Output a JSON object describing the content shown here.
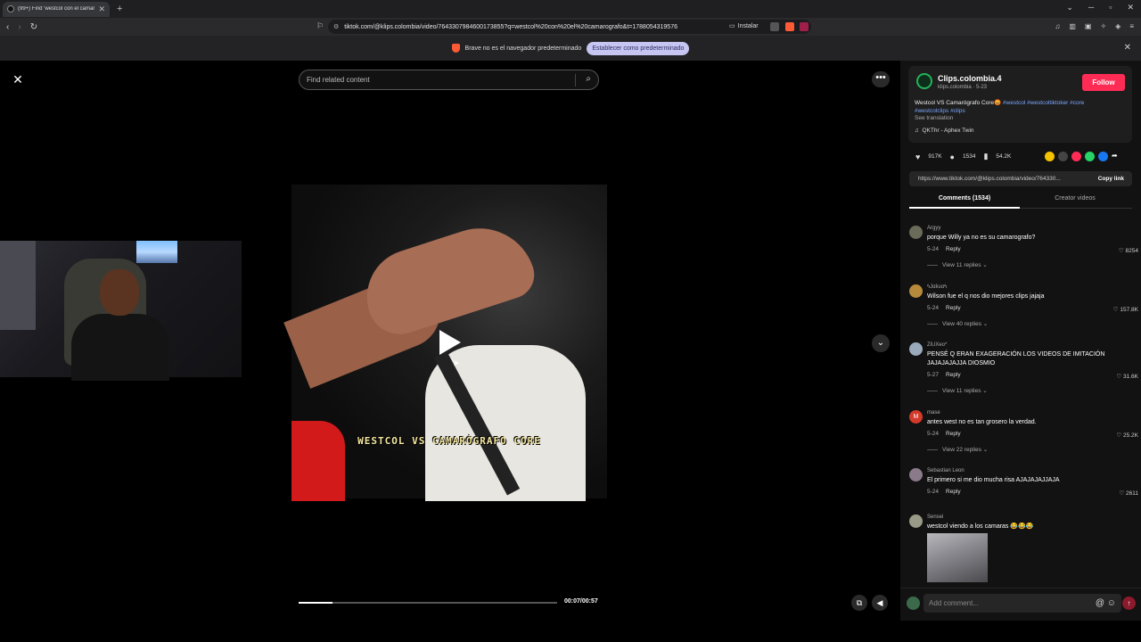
{
  "browser": {
    "tab_title": "(99+) Find 'westcol con el camar",
    "new_tab": "+",
    "url": "tiktok.com/@klips.colombia/video/7643307984600173855?q=westcol%20con%20el%20camarografo&t=1788054319576",
    "install_label": "Instalar",
    "infobar_text": "Brave no es el navegador predeterminado",
    "infobar_button": "Establecer como predeterminado"
  },
  "video": {
    "search_placeholder": "Find related content",
    "caption": "WESTCOL VS CAMARÓGRAFO CORE",
    "time": "00:07/00:57",
    "progress": 0.13
  },
  "post": {
    "author_name": "Clips.colombia.4",
    "author_handle": "klips.colombia · 5-23",
    "follow_label": "Follow",
    "desc_text": "Westcol VS Camarógrafo Core",
    "desc_tags_1": "#westcol #westcoltiktoker #core",
    "desc_tags_2": "#westcolclips #clips",
    "see_translation": "See translation",
    "music": "QKThr - Aphex Twin",
    "likes": "917K",
    "comments": "1534",
    "saves": "54.2K",
    "link": "https://www.tiktok.com/@klips.colombia/video/764330...",
    "copy_link": "Copy link"
  },
  "tabs": {
    "comments": "Comments (1534)",
    "creator_videos": "Creator videos"
  },
  "comments": [
    {
      "name": "Argyy",
      "text": "porque Willy ya no es su camarografo?",
      "date": "5-24",
      "reply": "Reply",
      "likes": "8254",
      "view_replies": "View 11 replies",
      "avatar_color": "#6b6b5a"
    },
    {
      "name": "ϟJɑƙʋɑϟ",
      "text": "Wilson fue el q nos dio mejores clips jajaja",
      "date": "5-24",
      "reply": "Reply",
      "likes": "157.8K",
      "view_replies": "View 40 replies",
      "avatar_color": "#b58a3a"
    },
    {
      "name": "ZiUXeo*",
      "text": "PENSÉ Q ERAN EXAGERACIÓN LOS VIDEOS DE IMITACIÓN JAJAJAJAJJA DIOSMIO",
      "date": "5-27",
      "reply": "Reply",
      "likes": "31.6K",
      "view_replies": "View 11 replies",
      "avatar_color": "#9aaabb"
    },
    {
      "name": "mase",
      "text": "antes west no es tan grosero la verdad.",
      "date": "5-24",
      "reply": "Reply",
      "likes": "25.2K",
      "view_replies": "View 22 replies",
      "avatar_color": "#d33a2a"
    },
    {
      "name": "Sebastian Leon",
      "text": "El primero si me dio mucha risa AJAJAJAJJAJA",
      "date": "5-24",
      "reply": "Reply",
      "likes": "2611",
      "view_replies": "",
      "avatar_color": "#8a7a8a"
    },
    {
      "name": "Sensei",
      "text": "westcol viendo a los camaras 😂😂😂",
      "date": "",
      "reply": "",
      "likes": "",
      "view_replies": "",
      "avatar_color": "#9a9a88"
    }
  ],
  "add_comment_placeholder": "Add comment...",
  "colors": {
    "follow": "#fe2c55",
    "tag": "#7aa6ff",
    "brave": "#ff5a36"
  }
}
